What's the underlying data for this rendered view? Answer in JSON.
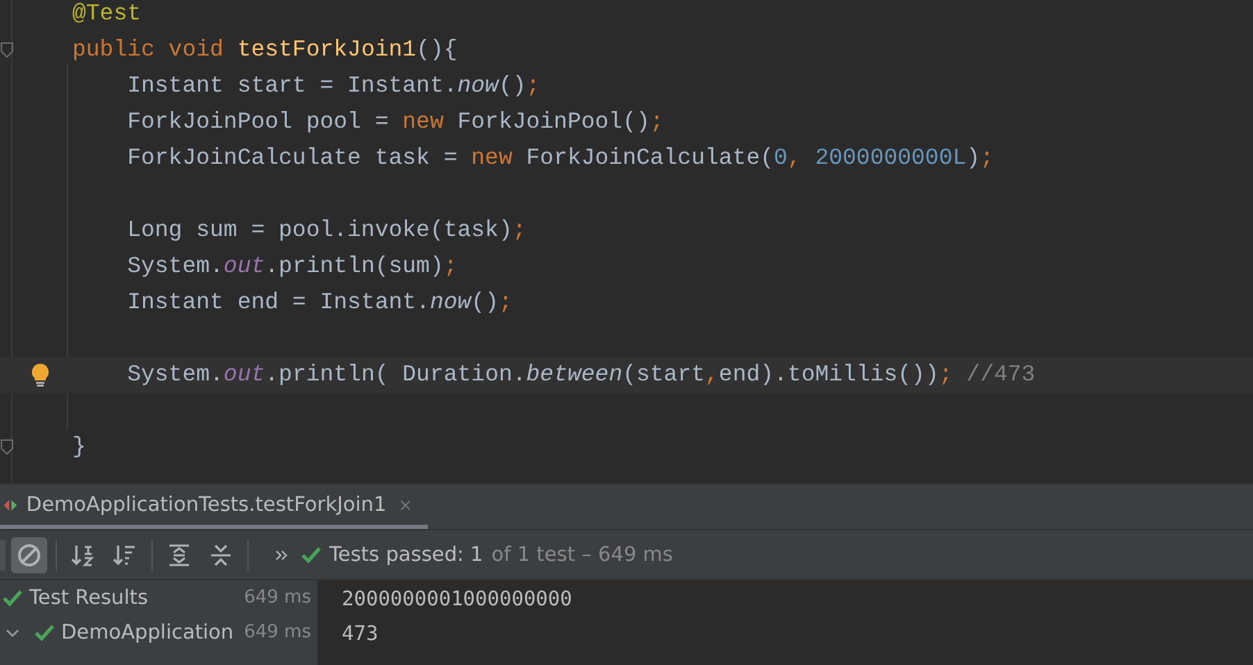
{
  "editor": {
    "lines": [
      {
        "kind": "code",
        "current": false,
        "tokens": [
          {
            "kind": "annotation",
            "text": "@Test"
          }
        ]
      },
      {
        "kind": "block-start",
        "current": false,
        "tokens": [
          {
            "kind": "keyword",
            "text": "public void "
          },
          {
            "kind": "declaration",
            "text": "testForkJoin1"
          },
          {
            "kind": "plain",
            "text": "(){"
          }
        ]
      },
      {
        "kind": "code",
        "current": false,
        "tokens": [
          {
            "kind": "plain",
            "text": "    Instant start = Instant."
          },
          {
            "kind": "static-method",
            "text": "now"
          },
          {
            "kind": "plain",
            "text": "()"
          },
          {
            "kind": "keyword",
            "text": ";"
          }
        ]
      },
      {
        "kind": "code",
        "current": false,
        "tokens": [
          {
            "kind": "plain",
            "text": "    ForkJoinPool pool = "
          },
          {
            "kind": "keyword",
            "text": "new "
          },
          {
            "kind": "plain",
            "text": "ForkJoinPool()"
          },
          {
            "kind": "keyword",
            "text": ";"
          }
        ]
      },
      {
        "kind": "code",
        "current": false,
        "tokens": [
          {
            "kind": "plain",
            "text": "    ForkJoinCalculate task = "
          },
          {
            "kind": "keyword",
            "text": "new "
          },
          {
            "kind": "plain",
            "text": "ForkJoinCalculate("
          },
          {
            "kind": "number",
            "text": "0"
          },
          {
            "kind": "keyword",
            "text": ", "
          },
          {
            "kind": "number",
            "text": "2000000000L"
          },
          {
            "kind": "plain",
            "text": ")"
          },
          {
            "kind": "keyword",
            "text": ";"
          }
        ]
      },
      {
        "kind": "blank"
      },
      {
        "kind": "code",
        "current": false,
        "tokens": [
          {
            "kind": "plain",
            "text": "    Long sum = pool.invoke(task)"
          },
          {
            "kind": "keyword",
            "text": ";"
          }
        ]
      },
      {
        "kind": "code",
        "current": false,
        "tokens": [
          {
            "kind": "plain",
            "text": "    System."
          },
          {
            "kind": "static-field",
            "text": "out"
          },
          {
            "kind": "plain",
            "text": ".println(sum)"
          },
          {
            "kind": "keyword",
            "text": ";"
          }
        ]
      },
      {
        "kind": "code",
        "current": false,
        "tokens": [
          {
            "kind": "plain",
            "text": "    Instant end = Instant."
          },
          {
            "kind": "static-method",
            "text": "now"
          },
          {
            "kind": "plain",
            "text": "()"
          },
          {
            "kind": "keyword",
            "text": ";"
          }
        ]
      },
      {
        "kind": "blank"
      },
      {
        "kind": "code",
        "current": true,
        "tokens": [
          {
            "kind": "plain",
            "text": "    System."
          },
          {
            "kind": "static-field",
            "text": "out"
          },
          {
            "kind": "plain",
            "text": ".println( Duration."
          },
          {
            "kind": "static-method",
            "text": "between"
          },
          {
            "kind": "plain",
            "text": "(start"
          },
          {
            "kind": "keyword",
            "text": ","
          },
          {
            "kind": "plain",
            "text": "end).toMillis())"
          },
          {
            "kind": "keyword",
            "text": "; "
          },
          {
            "kind": "comment",
            "text": "//473"
          }
        ]
      },
      {
        "kind": "blank"
      },
      {
        "kind": "block-end",
        "current": false,
        "tokens": [
          {
            "kind": "plain",
            "text": "}"
          }
        ]
      }
    ]
  },
  "run_panel": {
    "tab": {
      "title": "DemoApplicationTests.testForkJoin1",
      "selected": true
    },
    "toolbar": [
      {
        "kind": "cut-button",
        "selected": false
      },
      {
        "kind": "stop",
        "selected": true
      },
      {
        "kind": "sort-alpha",
        "selected": false
      },
      {
        "kind": "sort-duration",
        "selected": false
      },
      {
        "kind": "expand-all",
        "selected": false
      },
      {
        "kind": "collapse-all",
        "selected": false
      },
      {
        "kind": "more",
        "selected": false
      }
    ],
    "status": {
      "passed": true,
      "label": "Tests passed: 1",
      "detail": "of 1 test – 649 ms"
    },
    "tree": [
      {
        "label": "Test Results",
        "time": "649 ms",
        "passed": true,
        "selected": false,
        "children": [
          {
            "label": "DemoApplication",
            "time": "649 ms",
            "passed": true,
            "selected": false,
            "expanded": true
          }
        ]
      }
    ],
    "console": [
      "2000000001000000000",
      "473"
    ]
  }
}
